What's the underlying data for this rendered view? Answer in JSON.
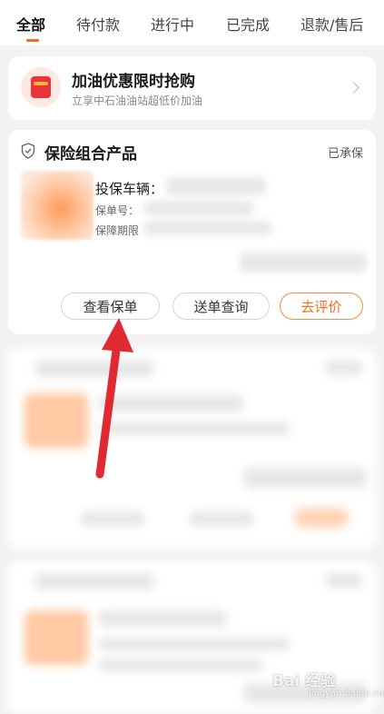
{
  "tabs": [
    {
      "label": "全部",
      "active": true
    },
    {
      "label": "待付款",
      "active": false
    },
    {
      "label": "进行中",
      "active": false
    },
    {
      "label": "已完成",
      "active": false
    },
    {
      "label": "退款/售后",
      "active": false
    }
  ],
  "promo": {
    "title": "加油优惠限时抢购",
    "subtitle": "立享中石油油站超低价加油",
    "icon": "red-envelope-icon"
  },
  "order": {
    "title": "保险组合产品",
    "status": "已承保",
    "vehicle_label": "投保车辆：",
    "policy_no_label": "保单号：",
    "period_label": "保障期限",
    "actions": {
      "view_policy": "查看保单",
      "delivery_query": "送单查询",
      "review": "去评价"
    }
  },
  "watermark": {
    "brand": "Bai 经验",
    "site": "jingyan.baidu.com"
  },
  "colors": {
    "accent": "#ff6a1a",
    "arrow": "#e02a32"
  }
}
